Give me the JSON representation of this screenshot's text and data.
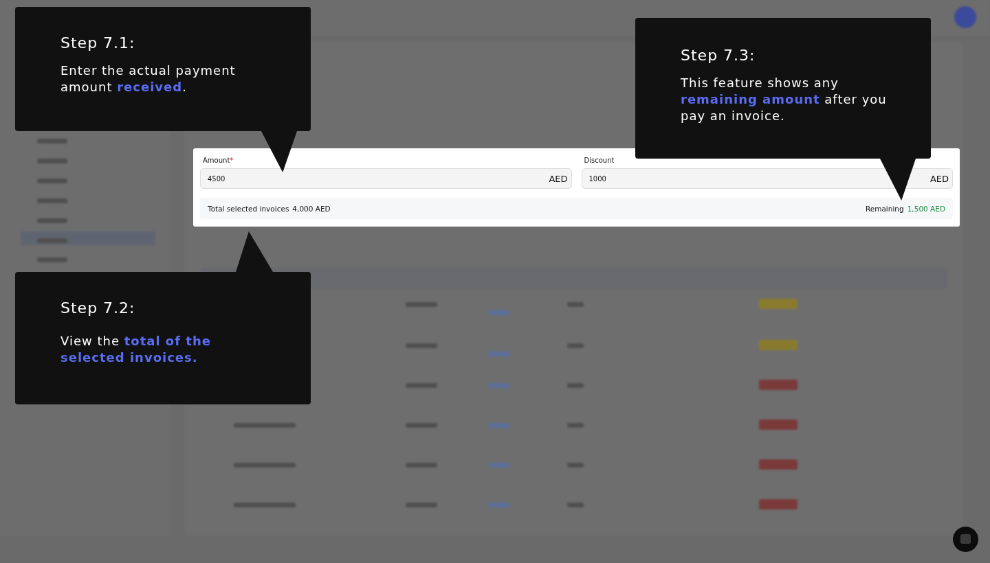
{
  "payment_panel": {
    "amount": {
      "label": "Amount",
      "required_mark": "*",
      "value": "4500",
      "currency": "AED"
    },
    "discount": {
      "label": "Discount",
      "value": "1000",
      "currency": "AED"
    },
    "summary": {
      "total_label": "Total selected invoices",
      "total_value": "4,000 AED",
      "remaining_label": "Remaining",
      "remaining_value": "1,500 AED"
    }
  },
  "tooltips": [
    {
      "step": "Step 7.1:",
      "text": "Enter the actual payment amount **received**.",
      "kind": "below-pointer"
    },
    {
      "step": "Step 7.2:",
      "text": "View the **total of the selected invoices.**",
      "kind": "above-pointer"
    },
    {
      "step": "Step 7.3:",
      "text": "This feature shows any **remaining amount** after you pay an invoice.",
      "kind": "below-pointer"
    }
  ]
}
